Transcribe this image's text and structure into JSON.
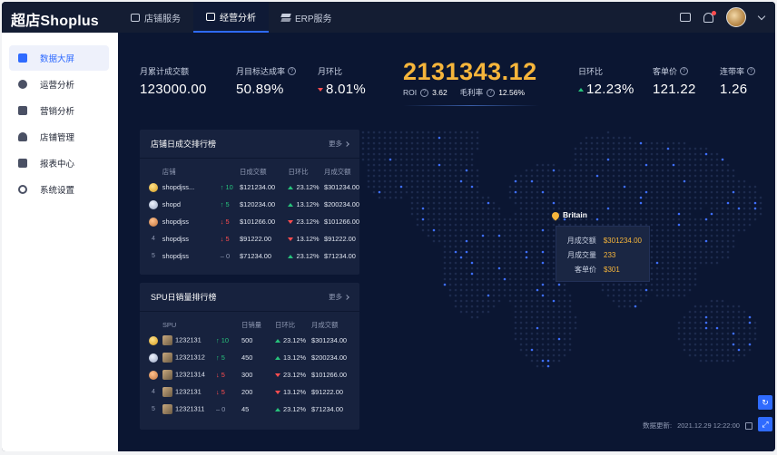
{
  "app": {
    "brand": "超店Shoplus"
  },
  "topnav": [
    {
      "label": "店铺服务",
      "icon": "shop-icon"
    },
    {
      "label": "经营分析",
      "icon": "chart-icon",
      "active": true
    },
    {
      "label": "ERP服务",
      "icon": "layers-icon"
    }
  ],
  "sidebar": [
    {
      "label": "数据大屏",
      "icon": "dashboard-icon",
      "active": true
    },
    {
      "label": "运营分析",
      "icon": "pie-chart-icon"
    },
    {
      "label": "营销分析",
      "icon": "megaphone-icon"
    },
    {
      "label": "店铺管理",
      "icon": "user-icon"
    },
    {
      "label": "报表中心",
      "icon": "report-icon"
    },
    {
      "label": "系统设置",
      "icon": "gear-icon"
    }
  ],
  "kpis": {
    "monthly_total": {
      "label": "月累计成交额",
      "value": "123000.00"
    },
    "month_target_rate": {
      "label": "月目标达成率",
      "value": "50.89%"
    },
    "month_ratio": {
      "label": "月环比",
      "value": "8.01%",
      "trend": "down"
    },
    "big": {
      "value": "2131343.12",
      "roi_label": "ROI",
      "roi_value": "3.62",
      "margin_label": "毛利率",
      "margin_value": "12.56%"
    },
    "day_ratio": {
      "label": "日环比",
      "value": "12.23%",
      "trend": "up"
    },
    "unit_price": {
      "label": "客单价",
      "value": "121.22"
    },
    "joint_rate": {
      "label": "连带率",
      "value": "1.26"
    }
  },
  "store_rank": {
    "title": "店铺日成交排行榜",
    "more": "更多",
    "headers": [
      "店铺",
      "",
      "日成交额",
      "日环比",
      "月成交额"
    ],
    "rows": [
      {
        "rank": "1",
        "name": "shopdjss...",
        "move": "10",
        "dir": "up",
        "day": "$121234.00",
        "ratio": "23.12%",
        "ratio_dir": "up",
        "month": "$301234.00"
      },
      {
        "rank": "2",
        "name": "shopd",
        "move": "5",
        "dir": "up",
        "day": "$120234.00",
        "ratio": "13.12%",
        "ratio_dir": "up",
        "month": "$200234.00"
      },
      {
        "rank": "3",
        "name": "shopdjss",
        "move": "5",
        "dir": "down",
        "day": "$101266.00",
        "ratio": "23.12%",
        "ratio_dir": "down",
        "month": "$101266.00"
      },
      {
        "rank": "4",
        "name": "shopdjss",
        "move": "5",
        "dir": "down",
        "day": "$91222.00",
        "ratio": "13.12%",
        "ratio_dir": "down",
        "month": "$91222.00"
      },
      {
        "rank": "5",
        "name": "shopdjss",
        "move": "0",
        "dir": "flat",
        "day": "$71234.00",
        "ratio": "23.12%",
        "ratio_dir": "up",
        "month": "$71234.00"
      }
    ]
  },
  "spu_rank": {
    "title": "SPU日销量排行榜",
    "more": "更多",
    "headers": [
      "SPU",
      "",
      "日销量",
      "日环比",
      "月成交额"
    ],
    "rows": [
      {
        "rank": "1",
        "name": "1232131",
        "move": "10",
        "dir": "up",
        "qty": "500",
        "ratio": "23.12%",
        "ratio_dir": "up",
        "month": "$301234.00"
      },
      {
        "rank": "2",
        "name": "12321312",
        "move": "5",
        "dir": "up",
        "qty": "450",
        "ratio": "13.12%",
        "ratio_dir": "up",
        "month": "$200234.00"
      },
      {
        "rank": "3",
        "name": "12321314",
        "move": "5",
        "dir": "down",
        "qty": "300",
        "ratio": "23.12%",
        "ratio_dir": "down",
        "month": "$101266.00"
      },
      {
        "rank": "4",
        "name": "1232131",
        "move": "5",
        "dir": "down",
        "qty": "200",
        "ratio": "13.12%",
        "ratio_dir": "down",
        "month": "$91222.00"
      },
      {
        "rank": "5",
        "name": "12321311",
        "move": "0",
        "dir": "flat",
        "qty": "45",
        "ratio": "23.12%",
        "ratio_dir": "up",
        "month": "$71234.00"
      }
    ]
  },
  "map_tip": {
    "country": "Britain",
    "rows": [
      {
        "k": "月成交额",
        "v": "$301234.00"
      },
      {
        "k": "月成交量",
        "v": "233"
      },
      {
        "k": "客单价",
        "v": "$301"
      }
    ]
  },
  "footer": {
    "update_label": "数据更新:",
    "update_time": "2021.12.29 12:22:00"
  },
  "colors": {
    "accent": "#2f6bff",
    "gold": "#f6b53b",
    "up": "#27c27b",
    "down": "#ff4d4f",
    "bg": "#0b1632"
  }
}
